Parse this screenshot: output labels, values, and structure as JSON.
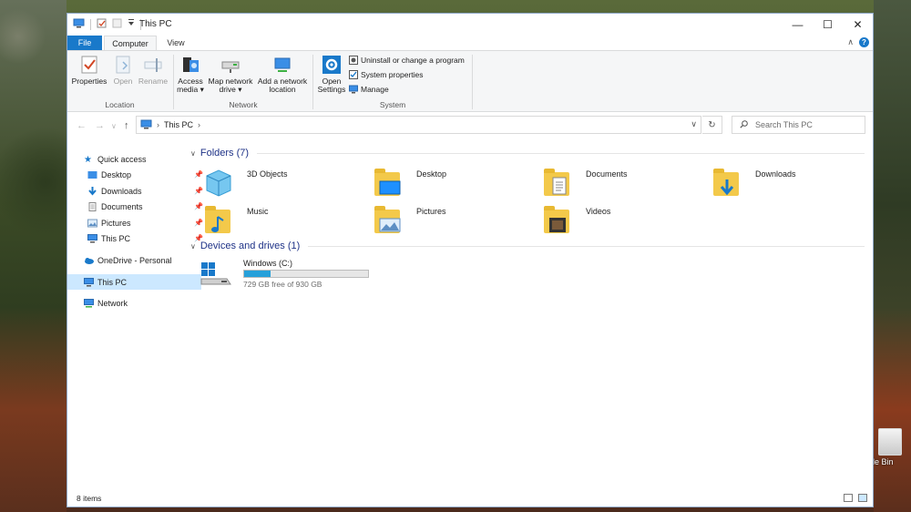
{
  "window": {
    "title": "This PC"
  },
  "ribbon": {
    "tabs": {
      "file": "File",
      "computer": "Computer",
      "view": "View"
    },
    "groups": {
      "location": {
        "label": "Location",
        "properties": "Properties",
        "open": "Open",
        "rename": "Rename"
      },
      "network": {
        "label": "Network",
        "access_media_1": "Access",
        "access_media_2": "media ▾",
        "map_drive_1": "Map network",
        "map_drive_2": "drive ▾",
        "add_location_1": "Add a network",
        "add_location_2": "location"
      },
      "system": {
        "label": "System",
        "open_settings_1": "Open",
        "open_settings_2": "Settings",
        "uninstall": "Uninstall or change a program",
        "system_properties": "System properties",
        "manage": "Manage"
      }
    }
  },
  "address": {
    "path": "This PC",
    "search_placeholder": "Search This PC"
  },
  "nav": {
    "quick_access": "Quick access",
    "desktop": "Desktop",
    "downloads": "Downloads",
    "documents": "Documents",
    "pictures": "Pictures",
    "this_pc_pinned": "This PC",
    "onedrive": "OneDrive - Personal",
    "this_pc": "This PC",
    "network": "Network"
  },
  "content": {
    "folders_header": "Folders (7)",
    "folders": {
      "objects3d": "3D Objects",
      "desktop": "Desktop",
      "documents": "Documents",
      "downloads": "Downloads",
      "music": "Music",
      "pictures": "Pictures",
      "videos": "Videos"
    },
    "devices_header": "Devices and drives (1)",
    "drive": {
      "name": "Windows (C:)",
      "free_text": "729 GB free of 930 GB",
      "used_fraction": 0.216
    }
  },
  "status": {
    "items": "8 items"
  },
  "desktop": {
    "recycle_label": "le Bin"
  },
  "colors": {
    "accent": "#1979ca",
    "selected": "#cce8ff",
    "header_blue": "#1e3287",
    "drive_fill": "#26a0da"
  }
}
